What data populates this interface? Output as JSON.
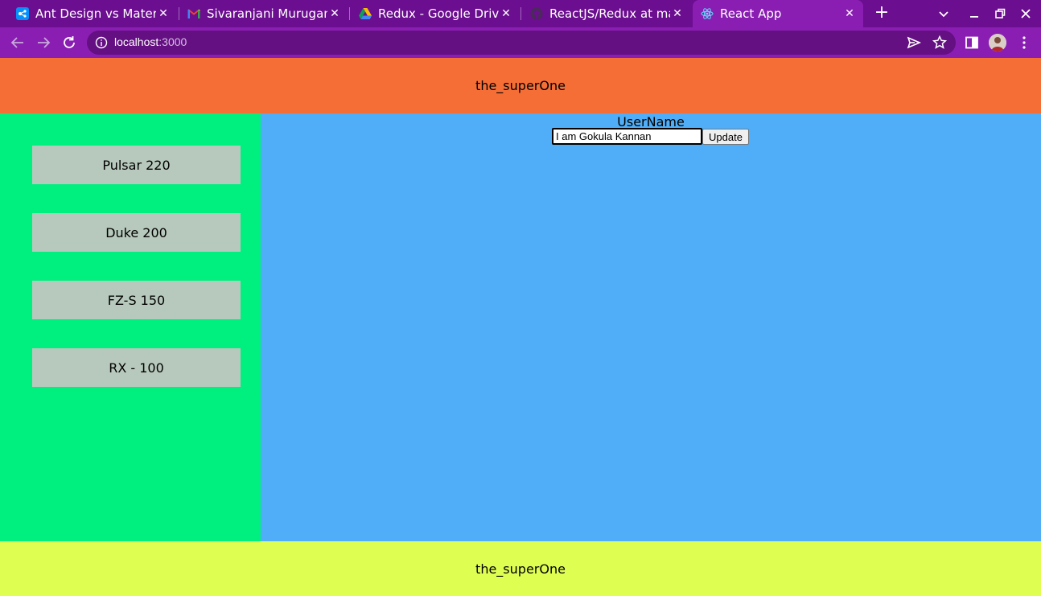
{
  "browser": {
    "tabs": [
      {
        "title": "Ant Design vs Materia",
        "icon": "stackshare-icon"
      },
      {
        "title": "Sivaranjani Murugan",
        "icon": "gmail-icon"
      },
      {
        "title": "Redux - Google Drive",
        "icon": "google-drive-icon"
      },
      {
        "title": "ReactJS/Redux at mai",
        "icon": "github-icon"
      },
      {
        "title": "React App",
        "icon": "react-icon",
        "active": true
      }
    ],
    "close_glyph": "✕",
    "newtab_glyph": "+",
    "address": {
      "host": "localhost",
      "port": ":3000"
    },
    "colors": {
      "tabstrip": "#6b0e8f",
      "toolbar": "#8a1eb3"
    }
  },
  "page": {
    "header_title": "the_superOne",
    "footer_title": "the_superOne",
    "sidebar": {
      "items": [
        "Pulsar 220",
        "Duke 200",
        "FZ-S 150",
        "RX - 100"
      ]
    },
    "main": {
      "username_label": "UserName",
      "username_value": "I am Gokula Kannan",
      "update_label": "Update"
    },
    "colors": {
      "header": "#f56e36",
      "sidebar": "#00f080",
      "sidebar_button": "#b7c9bc",
      "main": "#50aef8",
      "footer": "#dffe52"
    }
  }
}
